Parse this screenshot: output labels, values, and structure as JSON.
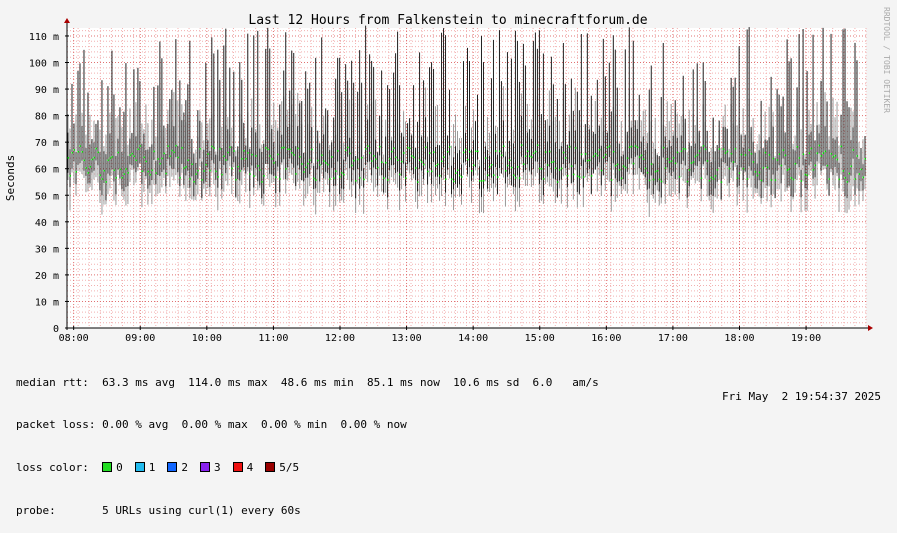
{
  "chart_data": {
    "type": "line",
    "title": "Last 12 Hours from Falkenstein to minecraftforum.de",
    "ylabel": "Seconds",
    "watermark": "RRDTOOL / TOBI OETIKER",
    "ylim": [
      0,
      113
    ],
    "yunit_labels": [
      "0",
      "10 m",
      "20 m",
      "30 m",
      "40 m",
      "50 m",
      "60 m",
      "70 m",
      "80 m",
      "90 m",
      "100 m",
      "110 m"
    ],
    "yticks": [
      0,
      10,
      20,
      30,
      40,
      50,
      60,
      70,
      80,
      90,
      100,
      110
    ],
    "x_hours": [
      "08:00",
      "09:00",
      "10:00",
      "11:00",
      "12:00",
      "13:00",
      "14:00",
      "15:00",
      "16:00",
      "17:00",
      "18:00",
      "19:00"
    ],
    "x_start": "07:54",
    "x_end": "19:54",
    "median_rtt_ms": {
      "avg": 63.3,
      "max": 114.0,
      "min": 48.6,
      "now": 85.1,
      "sd": 10.6
    },
    "colors": {
      "median": "#00dd00",
      "smoke_dark": "#202020",
      "smoke_light": "#9a9a9a",
      "grid_minor": "#f2b0b0",
      "grid_major": "#e07070",
      "axis": "#000000",
      "arrow": "#aa0000"
    }
  },
  "stats": {
    "median_rtt": "median rtt:  63.3 ms avg  114.0 ms max  48.6 ms min  85.1 ms now  10.6 ms sd  6.0   am/s",
    "packet_loss": "packet loss: 0.00 % avg  0.00 % max  0.00 % min  0.00 % now",
    "loss_color_label": "loss color:",
    "probe": "probe:       5 URLs using curl(1) every 60s",
    "timestamp": "Fri May  2 19:54:37 2025"
  },
  "loss_colors": [
    {
      "label": "0",
      "color": "#22dd22"
    },
    {
      "label": "1",
      "color": "#22bbee"
    },
    {
      "label": "2",
      "color": "#1166ff"
    },
    {
      "label": "3",
      "color": "#8822ee"
    },
    {
      "label": "4",
      "color": "#ee1111"
    },
    {
      "label": "5/5",
      "color": "#990000"
    }
  ]
}
